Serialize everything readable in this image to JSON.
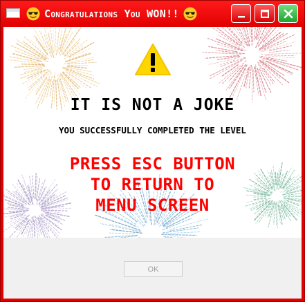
{
  "window": {
    "title": "Congratulations You WON!!",
    "title_emoji": "smiling-face-with-sunglasses",
    "controls": [
      "minimize",
      "maximize",
      "close"
    ]
  },
  "dialog": {
    "icon": "warning-icon",
    "headline": "IT IS NOT A JOKE",
    "subline": "YOU SUCCESSFULLY COMPLETED THE LEVEL",
    "instruction_lines": [
      "PRESS ESC BUTTON",
      "TO RETURN TO",
      "MENU SCREEN"
    ],
    "ok_label": "OK"
  },
  "colors": {
    "frame": "#e00000",
    "instruction": "#ff0000",
    "close_button": "#22a033",
    "warning": "#ffd600"
  }
}
